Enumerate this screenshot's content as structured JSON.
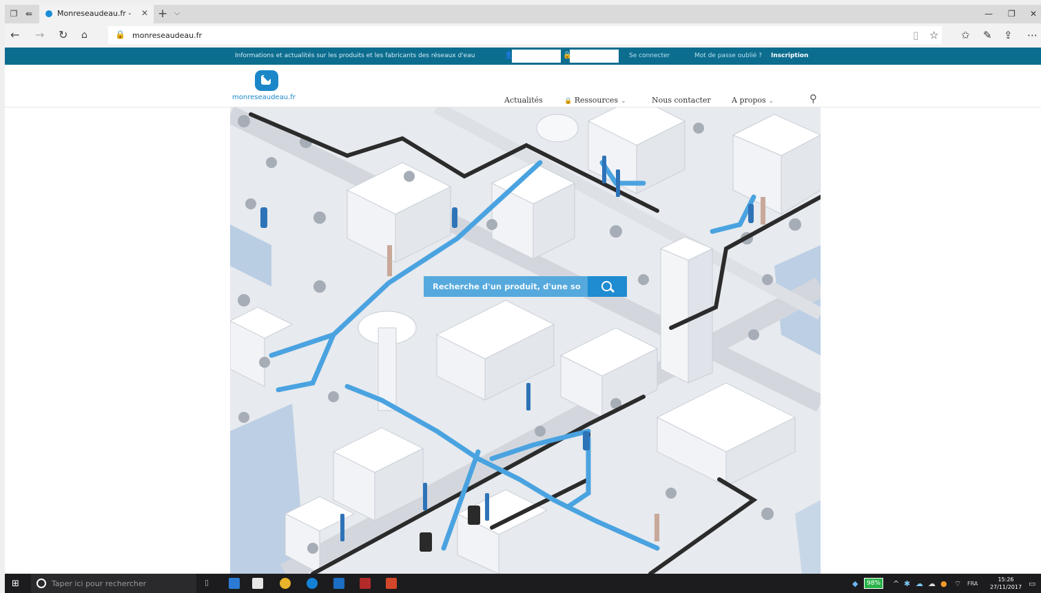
{
  "browser": {
    "tab_title": "Monreseaudeau.fr - Info",
    "new_tab_glyph": "+",
    "tab_list_glyph": "⌵",
    "close_glyph": "✕",
    "address": "monreseaudeau.fr",
    "icons": [
      "tab-preview-icon",
      "set-aside-icon",
      "back-icon",
      "forward-icon",
      "refresh-icon",
      "home-icon",
      "lock-icon",
      "reading-view-icon",
      "favorite-star-icon",
      "favorites-icon",
      "pen-icon",
      "share-icon",
      "more-icon"
    ]
  },
  "site": {
    "topbar": {
      "info": "Informations et actualités sur les produits et les fabricants des réseaux d'eau",
      "login_placeholder": "",
      "password_placeholder": "",
      "connect": "Se connecter",
      "forgot": "Mot de passe oublié ?",
      "register": "Inscription"
    },
    "logo": {
      "text": "monreseaudeau.fr"
    },
    "nav": [
      {
        "label": "Actualités"
      },
      {
        "label": "Ressources",
        "locked": true,
        "dropdown": true
      },
      {
        "label": "Nous contacter"
      },
      {
        "label": "A propos",
        "dropdown": true
      }
    ],
    "nav_lock_glyph": "🔒",
    "chevron_glyph": "⌄",
    "search_icon": "search-icon",
    "hero": {
      "search_placeholder": "Recherche d'un produit, d'une so",
      "accent": "#1f8bd1",
      "pipe_blue": "#4aa3e0",
      "pipe_black": "#2b2b2b"
    }
  },
  "taskbar": {
    "search_placeholder": "Taper ici pour rechercher",
    "battery": "98%",
    "language": "FRA",
    "time": "15:26",
    "date": "27/11/2017"
  }
}
